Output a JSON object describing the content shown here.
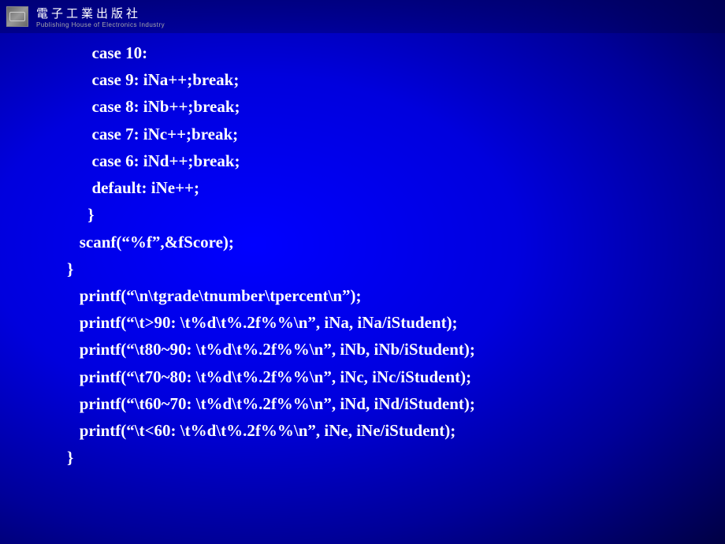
{
  "header": {
    "logo_alt": "publisher-logo",
    "title_cn": "電子工業出版社",
    "title_en": "Publishing House of Electronics Industry"
  },
  "code": {
    "lines": [
      "      case 10:",
      "      case 9: iNa++;break;",
      "      case 8: iNb++;break;",
      "      case 7: iNc++;break;",
      "      case 6: iNd++;break;",
      "      default: iNe++;",
      "     }",
      "   scanf(“%f”,&fScore);",
      "}",
      "   printf(“\\n\\tgrade\\tnumber\\tpercent\\n”);",
      "   printf(“\\t>90: \\t%d\\t%.2f%%\\n”, iNa, iNa/iStudent);",
      "   printf(“\\t80~90: \\t%d\\t%.2f%%\\n”, iNb, iNb/iStudent);",
      "   printf(“\\t70~80: \\t%d\\t%.2f%%\\n”, iNc, iNc/iStudent);",
      "   printf(“\\t60~70: \\t%d\\t%.2f%%\\n”, iNd, iNd/iStudent);",
      "   printf(“\\t<60: \\t%d\\t%.2f%%\\n”, iNe, iNe/iStudent);",
      "}"
    ]
  }
}
